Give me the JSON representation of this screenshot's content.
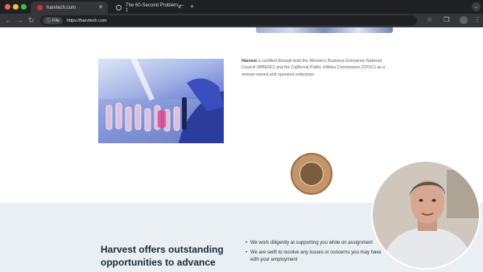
{
  "browser": {
    "tabs": [
      {
        "title": "harvtech.com",
        "active": true
      },
      {
        "title": "The 60-Second Problem — ‡",
        "active": false
      }
    ],
    "new_tab_label": "+",
    "address": {
      "chip_label": "File",
      "url": "https://harvtech.com"
    }
  },
  "page": {
    "certification_text_bold": "Harvest",
    "certification_text": " is certified through both the Women's Business Enterprise National Council (WBENC) and the California Public Utilities Commission (CPUC) as a woman owned and operated enterprise.",
    "headline": "Harvest offers outstanding opportunities to advance your",
    "bullets": [
      "We work diligently at supporting you while on assignment",
      "We are swift to resolve any issues or concerns you may have with your employment"
    ]
  },
  "colors": {
    "tabbar_bg": "#1f2023",
    "toolbar_bg": "#35363a",
    "lower_section_bg": "#e9eff3",
    "headline_color": "#1d2b3a"
  }
}
